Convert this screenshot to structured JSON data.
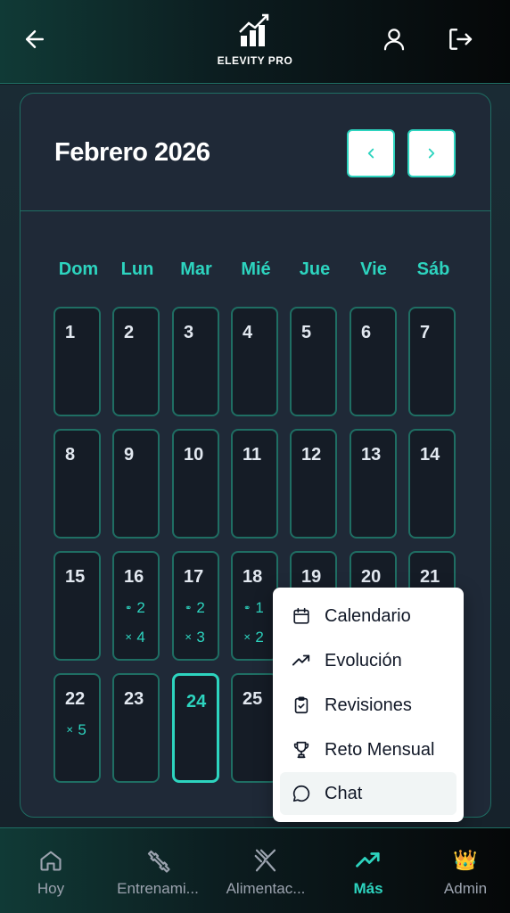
{
  "header": {
    "logo_text": "ELEVITY PRO",
    "back_icon": "arrow-left-icon",
    "profile_icon": "user-icon",
    "logout_icon": "logout-icon"
  },
  "calendar": {
    "month_title": "Febrero 2026",
    "prev_icon": "chevron-left-icon",
    "next_icon": "chevron-right-icon",
    "weekdays": [
      "Dom",
      "Lun",
      "Mar",
      "Mié",
      "Jue",
      "Vie",
      "Sáb"
    ],
    "days": [
      "1",
      "2",
      "3",
      "4",
      "5",
      "6",
      "7",
      "8",
      "9",
      "10",
      "11",
      "12",
      "13",
      "14",
      "15",
      "16",
      "17",
      "18",
      "19",
      "20",
      "21",
      "22",
      "23",
      "24",
      "25"
    ],
    "today": "24",
    "badges": {
      "d16": {
        "workout": "2",
        "meal": "4"
      },
      "d17": {
        "workout": "2",
        "meal": "3"
      },
      "d18": {
        "workout": "1",
        "meal": "2"
      },
      "d22": {
        "meal": "5"
      }
    }
  },
  "menu": {
    "items": [
      {
        "label": "Calendario",
        "icon": "calendar-icon"
      },
      {
        "label": "Evolución",
        "icon": "trending-up-icon"
      },
      {
        "label": "Revisiones",
        "icon": "clipboard-check-icon"
      },
      {
        "label": "Reto Mensual",
        "icon": "trophy-icon"
      },
      {
        "label": "Chat",
        "icon": "chat-bubble-icon"
      }
    ]
  },
  "bottom_nav": {
    "tabs": [
      {
        "label": "Hoy",
        "icon": "home-icon"
      },
      {
        "label": "Entrenami...",
        "icon": "dumbbell-icon"
      },
      {
        "label": "Alimentac...",
        "icon": "utensils-icon"
      },
      {
        "label": "Más",
        "icon": "trending-up-icon"
      },
      {
        "label": "Admin",
        "icon": "crown-icon"
      }
    ],
    "active": "Más"
  },
  "colors": {
    "accent": "#2dd4bf",
    "border": "#1f6e63",
    "card_bg": "#1f2937",
    "cell_bg": "#151c26"
  }
}
